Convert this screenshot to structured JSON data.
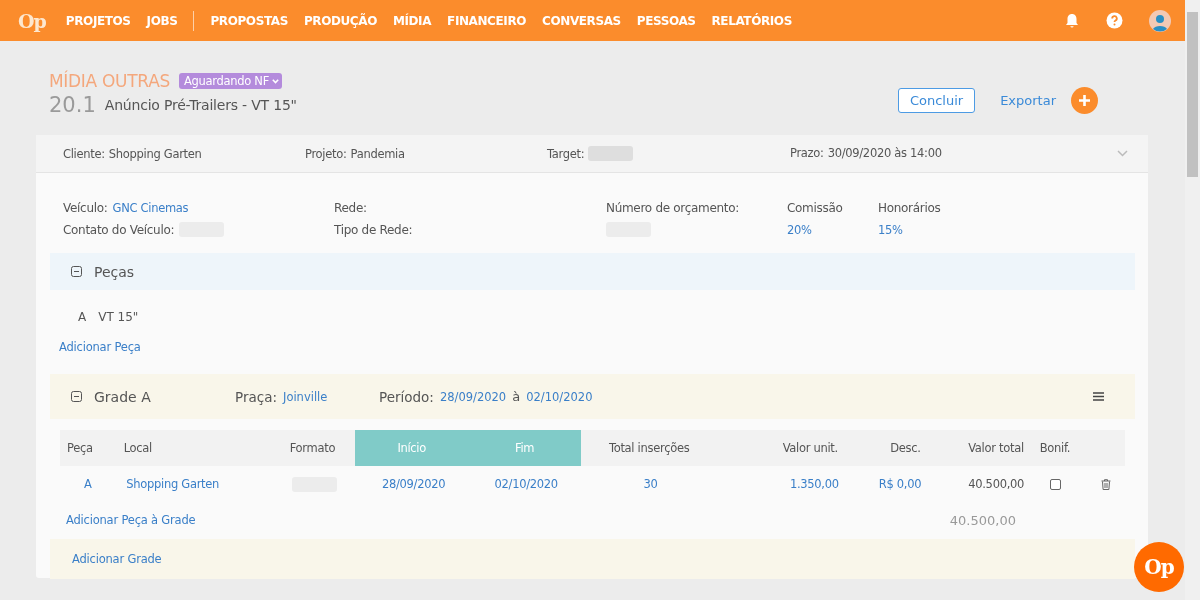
{
  "header": {
    "logo": "Op",
    "nav": [
      {
        "label": "PROJETOS",
        "divider_after": false
      },
      {
        "label": "JOBS",
        "divider_after": true
      },
      {
        "label": "PROPOSTAS",
        "divider_after": false
      },
      {
        "label": "PRODUÇÃO",
        "divider_after": false
      },
      {
        "label": "MÍDIA",
        "divider_after": false
      },
      {
        "label": "FINANCEIRO",
        "divider_after": false
      },
      {
        "label": "CONVERSAS",
        "divider_after": false
      },
      {
        "label": "PESSOAS",
        "divider_after": false
      },
      {
        "label": "RELATÓRIOS",
        "divider_after": false
      }
    ]
  },
  "page": {
    "category": "MÍDIA OUTRAS",
    "status": "Aguardando NF",
    "number": "20.1",
    "title": "Anúncio Pré-Trailers - VT 15\"",
    "buttons": {
      "conclude": "Concluir",
      "export": "Exportar"
    }
  },
  "summary": [
    {
      "label": "Cliente:",
      "value": "Shopping Garten",
      "redacted": false
    },
    {
      "label": "Projeto:",
      "value": "Pandemia",
      "redacted": false
    },
    {
      "label": "Target:",
      "redacted": true
    },
    {
      "label": "Prazo:",
      "value": "30/09/2020 às 14:00",
      "redacted": false
    }
  ],
  "details": {
    "veiculo_label": "Veículo:",
    "veiculo": "GNC Cinemas",
    "contato_label": "Contato do Veículo:",
    "rede_label": "Rede:",
    "tipo_rede_label": "Tipo de Rede:",
    "orcamento_label": "Número de orçamento:",
    "comissao_label": "Comissão",
    "comissao": "20%",
    "honorarios_label": "Honorários",
    "honorarios": "15%"
  },
  "pecas": {
    "title": "Peças",
    "items": [
      {
        "letter": "A",
        "name": "VT 15\""
      }
    ],
    "add_link": "Adicionar Peça"
  },
  "grade": {
    "title": "Grade A",
    "praca_label": "Praça:",
    "praca": "Joinville",
    "periodo_label": "Período:",
    "start": "28/09/2020",
    "separator": "à",
    "end": "02/10/2020",
    "columns": [
      {
        "label": "Peça",
        "highlighted": false
      },
      {
        "label": "Local",
        "highlighted": false
      },
      {
        "label": "Formato",
        "highlighted": false
      },
      {
        "label": "Início",
        "highlighted": true
      },
      {
        "label": "Fim",
        "highlighted": true
      },
      {
        "label": "Total inserções",
        "highlighted": false
      },
      {
        "label": "Valor unit.",
        "highlighted": false
      },
      {
        "label": "Desc.",
        "highlighted": false
      },
      {
        "label": "Valor total",
        "highlighted": false
      },
      {
        "label": "Bonif.",
        "highlighted": false
      }
    ],
    "rows": [
      {
        "peca": "A",
        "local": "Shopping Garten",
        "inicio": "28/09/2020",
        "fim": "02/10/2020",
        "insercoes": "30",
        "valor_unit": "1.350,00",
        "desc": "R$ 0,00",
        "valor_total": "40.500,00",
        "bonif_checked": false
      }
    ],
    "add_link": "Adicionar Peça à Grade",
    "total": "40.500,00"
  },
  "add_grade": "Adicionar Grade",
  "fab": "Op"
}
